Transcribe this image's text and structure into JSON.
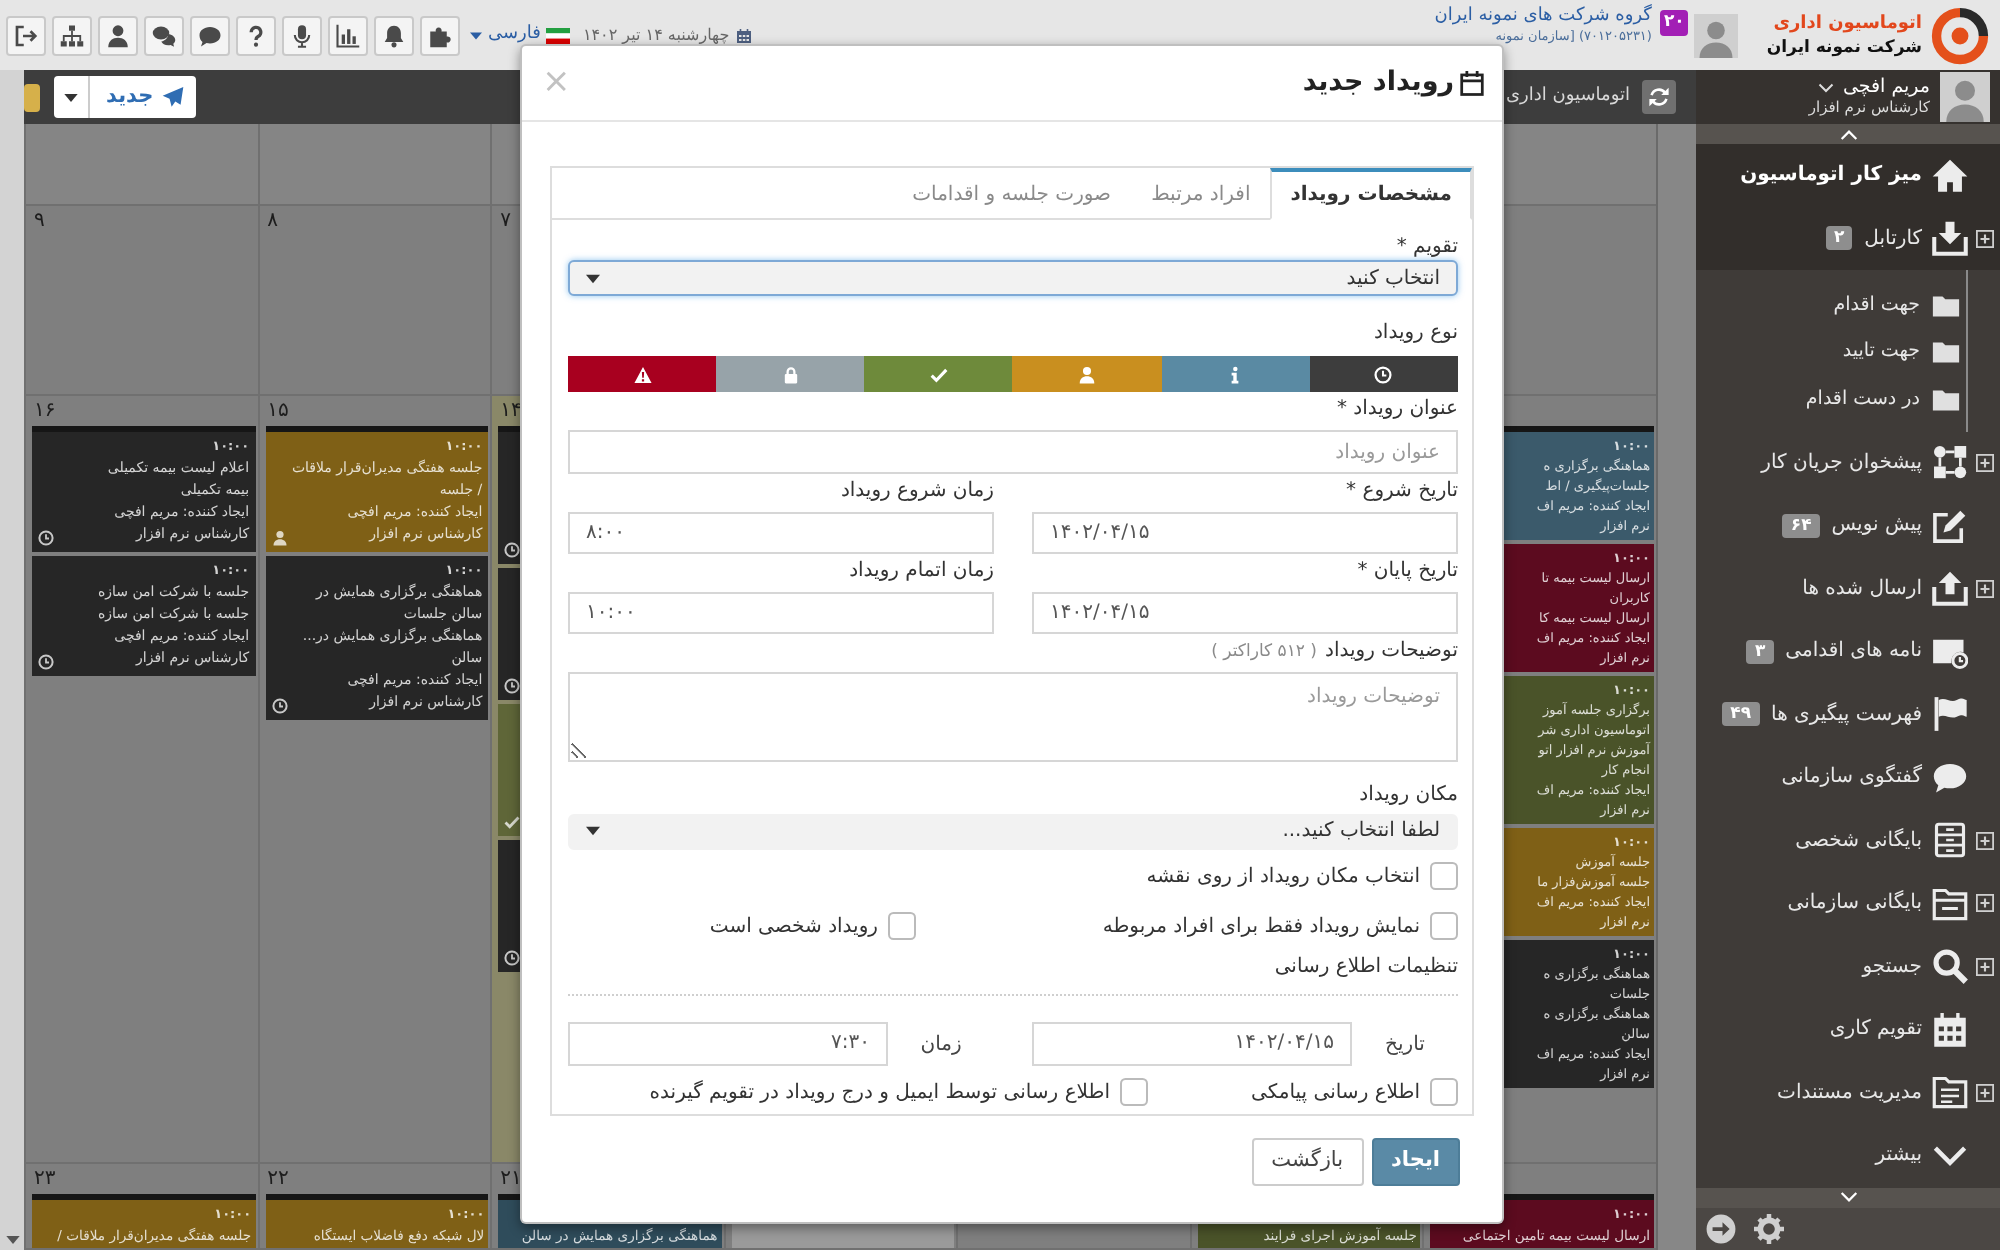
{
  "top_bar": {
    "logo": {
      "title": "اتوماسیون اداری",
      "subtitle": "شرکت نمونه ایران"
    },
    "notification_count": "۲۰",
    "company": {
      "name": "گروه شرکت های نمونه ایران",
      "detail": "(۷۰۱۲۰۵۲۳۱) [سازمان نمونه"
    },
    "date": "چهارشنبه ۱۴ تیر ۱۴۰۲",
    "language": "فارسی"
  },
  "toolbar": {
    "new_button": "جدید",
    "breadcrumb": "اتوماسیون اداری"
  },
  "sidebar": {
    "user": {
      "name": "مریم افچی",
      "role": "کارشناس نرم افزار"
    },
    "items": [
      {
        "label": "میز کار اتوماسیون",
        "selected": true,
        "expandable": false
      },
      {
        "label": "کارتابل",
        "badge": "۲",
        "selected": false,
        "expandable": true,
        "children": [
          {
            "label": "جهت اقدام",
            "selected": false
          },
          {
            "label": "جهت تایید",
            "selected": false
          },
          {
            "label": "در دست اقدام",
            "selected": false
          }
        ]
      },
      {
        "label": "پیشخوان جریان کار",
        "selected": false,
        "expandable": true
      },
      {
        "label": "پیش نویس",
        "badge": "۶۴",
        "selected": false,
        "expandable": false
      },
      {
        "label": "ارسال شده ها",
        "selected": false,
        "expandable": true
      },
      {
        "label": "نامه های اقدامی",
        "badge": "۳",
        "selected": false,
        "expandable": false
      },
      {
        "label": "فهرست پیگیری ها",
        "badge": "۴۹",
        "selected": false,
        "expandable": false
      },
      {
        "label": "گفتگوی سازمانی",
        "selected": false,
        "expandable": false
      },
      {
        "label": "بایگانی شخصی",
        "selected": false,
        "expandable": true
      },
      {
        "label": "بایگانی سازمانی",
        "selected": false,
        "expandable": true
      },
      {
        "label": "جستجو",
        "selected": false,
        "expandable": true
      },
      {
        "label": "تقویم کاری",
        "selected": false,
        "expandable": false
      },
      {
        "label": "مدیریت مستندات",
        "selected": false,
        "expandable": true
      },
      {
        "label": "بیشتر",
        "selected": false,
        "expandable": false
      }
    ]
  },
  "calendar": {
    "weeks": [
      {
        "days": [
          {
            "today": false
          },
          {
            "number": "۷",
            "today": false
          },
          {
            "number": "۸",
            "today": false
          },
          {
            "number": "۹",
            "today": false
          }
        ]
      },
      {
        "days": [
          {
            "today": false,
            "events": [
              {
                "time": "۱۰:۰۰",
                "lines": [
                  "هماهنگی برگزاری ه",
                  "جلسات‌پیگیری / اط",
                  "ایجاد کننده: مریم اف",
                  "نرم افزار"
                ],
                "color": "#3b5a6b"
              },
              {
                "time": "۱۰:۰۰",
                "lines": [
                  "ارسال لیست بیمه تا",
                  "کاربران",
                  "ارسال لیست بیمه کا",
                  "ایجاد کننده: مریم اف",
                  "نرم افزار"
                ],
                "color": "#5c0b1f"
              },
              {
                "time": "۱۰:۰۰",
                "lines": [
                  "برگزاری جلسه آموز",
                  "اتوماسیون اداری شر",
                  "آموزش نرم افزار اتو",
                  "انجام کار",
                  "ایجاد کننده: مریم اف",
                  "نرم افزار"
                ],
                "color": "#4a5329"
              },
              {
                "time": "۱۰:۰۰",
                "lines": [
                  "جلسه آموزش",
                  "جلسه آموزش‌فزار ما",
                  "ایجاد کننده: مریم اف",
                  "نرم افزار"
                ],
                "color": "#7f6016"
              },
              {
                "time": "۱۰:۰۰",
                "lines": [
                  "هماهنگی برگزاری ه",
                  "جلسات",
                  "هماهنگی برگزاری ه",
                  "سالن",
                  "ایجاد کننده: مریم اف",
                  "نرم افزار"
                ],
                "color": "#262626"
              }
            ]
          },
          {
            "number": "۱۴",
            "today": true,
            "events": [
              {
                "color": "#262626",
                "kind": "timed"
              },
              {
                "color": "#262626",
                "kind": "timed"
              },
              {
                "color": "#5f6638",
                "kind": "done"
              },
              {
                "color": "#262626",
                "kind": "timed"
              }
            ]
          },
          {
            "number": "۱۵",
            "today": false,
            "events": [
              {
                "time": "۱۰:۰۰",
                "lines": [
                  "جلسه هفتگی مدیران‌قرار ملاقات / جلسه",
                  "ایجاد کننده: مریم افچی کارشناس نرم افزار"
                ],
                "color": "#7f6016",
                "kind": "personal"
              },
              {
                "time": "۱۰:۰۰",
                "lines": [
                  "هماهنگی برگزاری همایش در سالن جلسات",
                  "هماهنگی برگزاری همایش در... سالن",
                  "ایجاد کننده: مریم افچی کارشناس نرم افزار"
                ],
                "color": "#262626",
                "kind": "timed"
              }
            ]
          },
          {
            "number": "۱۶",
            "today": false,
            "events": [
              {
                "time": "۱۰:۰۰",
                "lines": [
                  "اعلام لیست بیمه تکمیلی",
                  "بیمه تکمیلی",
                  "ایجاد کننده: مریم افچی کارشناس نرم افزار"
                ],
                "color": "#262626",
                "kind": "timed"
              },
              {
                "time": "۱۰:۰۰",
                "lines": [
                  "جلسه با شرکت امن سازه",
                  "جلسه با شرکت امن سازه",
                  "ایجاد کننده: مریم افچی کارشناس نرم افزار"
                ],
                "color": "#262626",
                "kind": "timed"
              }
            ]
          }
        ]
      },
      {
        "days": [
          {
            "today": false,
            "events": [
              {
                "time": "۱۰:۰۰",
                "lines": [
                  "ارسال لیست بیمه تامین اجتماعی"
                ],
                "color": "#5c0b1f"
              }
            ]
          },
          {
            "today": false,
            "events": [
              {
                "lines": [
                  "جلسه آموزش اجرای فرایند"
                ],
                "color": "#4a5329"
              }
            ]
          },
          {
            "today": false
          },
          {
            "today": false,
            "events": [
              {
                "color": "#9a9a9a"
              }
            ]
          },
          {
            "number": "۲۱",
            "today": false,
            "events": [
              {
                "lines": [
                  "هماهنگی برگزاری همایش در سالن"
                ],
                "color": "#2f4c5b"
              }
            ]
          },
          {
            "number": "۲۲",
            "today": false,
            "events": [
              {
                "time": "۱۰:۰۰",
                "lines": [
                  "لال شبکه دفع فاضلاب ایستگاه"
                ],
                "color": "#7f6016"
              }
            ]
          },
          {
            "number": "۲۳",
            "today": false,
            "events": [
              {
                "time": "۱۰:۰۰",
                "lines": [
                  "جلسه هفتگی مدیران‌قرار ملاقات /"
                ],
                "color": "#7f6016"
              }
            ]
          }
        ]
      }
    ]
  },
  "modal": {
    "title": "رویداد جدید",
    "close": "×",
    "tabs": [
      {
        "label": "مشخصات رویداد",
        "selected": true
      },
      {
        "label": "افراد مرتبط",
        "selected": false
      },
      {
        "label": "صورت جلسه و اقدامات",
        "selected": false
      }
    ],
    "calendar_field": {
      "label": "تقویم *",
      "value": "انتخاب کنید",
      "focused": true
    },
    "event_type": {
      "label": "نوع رویداد",
      "options": [
        {
          "color": "#3d3d3d",
          "selected": false
        },
        {
          "color": "#5a8aa3",
          "selected": false
        },
        {
          "color": "#c98f1f",
          "selected": false
        },
        {
          "color": "#6e8a3b",
          "selected": false
        },
        {
          "color": "#97a3a9",
          "selected": false
        },
        {
          "color": "#a8001f",
          "selected": false
        }
      ]
    },
    "title_field": {
      "label": "عنوان رویداد *",
      "placeholder": "عنوان رویداد"
    },
    "start_date": {
      "label": "تاریخ شروع *",
      "value": "۱۴۰۲/۰۴/۱۵"
    },
    "start_time": {
      "label": "زمان شروع رویداد",
      "value": "۸:۰۰"
    },
    "end_date": {
      "label": "تاریخ پایان *",
      "value": "۱۴۰۲/۰۴/۱۵"
    },
    "end_time": {
      "label": "زمان اتمام رویداد",
      "value": "۱۰:۰۰"
    },
    "description": {
      "label": "توضیحات رویداد",
      "hint": "( ۵۱۲ کاراکتر )",
      "placeholder": "توضیحات رویداد"
    },
    "location": {
      "label": "مکان رویداد",
      "value": "لطفا انتخاب کنید..."
    },
    "option_rows": [
      [
        {
          "label": "انتخاب مکان رویداد از روی نقشه",
          "checked": false
        }
      ],
      [
        {
          "label": "نمایش رویداد فقط برای افراد مربوطه",
          "checked": false
        },
        {
          "label": "رویداد شخصی است",
          "checked": false
        }
      ]
    ],
    "notification": {
      "title": "تنظیمات اطلاع رسانی",
      "date": {
        "label": "تاریخ",
        "value": "۱۴۰۲/۰۴/۱۵"
      },
      "time": {
        "label": "زمان",
        "value": "۷:۳۰"
      },
      "options": [
        {
          "label": "اطلاع رسانی پیامکی",
          "checked": false
        },
        {
          "label": "اطلاع رسانی توسط ایمیل و درج رویداد در تقویم گیرنده",
          "checked": false
        }
      ]
    },
    "buttons": [
      {
        "label": "ایجاد",
        "kind": "primary"
      },
      {
        "label": "بازگشت",
        "kind": "secondary"
      }
    ]
  }
}
